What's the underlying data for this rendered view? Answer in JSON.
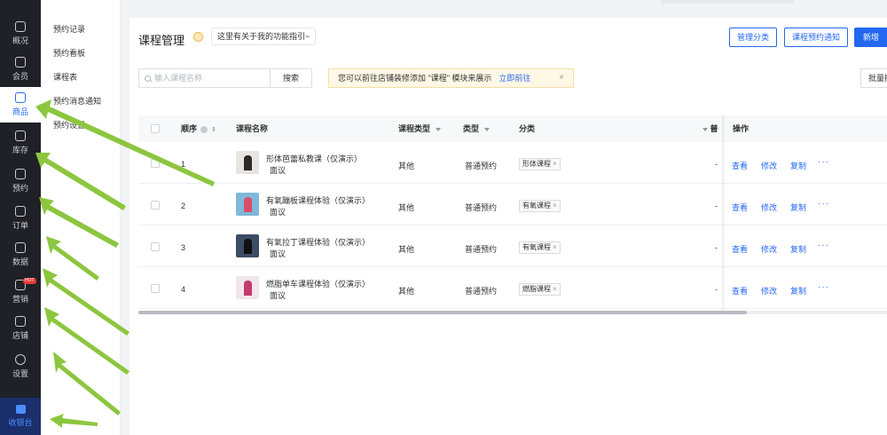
{
  "nav": {
    "items": [
      {
        "label": "概况",
        "icon": "overview-icon"
      },
      {
        "label": "会员",
        "icon": "member-icon"
      },
      {
        "label": "商品",
        "icon": "goods-icon",
        "active": true
      },
      {
        "label": "库存",
        "icon": "inventory-icon"
      },
      {
        "label": "预约",
        "icon": "booking-icon"
      },
      {
        "label": "订单",
        "icon": "order-icon"
      },
      {
        "label": "数据",
        "icon": "data-icon"
      },
      {
        "label": "营销",
        "icon": "marketing-icon",
        "badge": "HOT"
      },
      {
        "label": "店铺",
        "icon": "shop-icon"
      },
      {
        "label": "设置",
        "icon": "settings-icon"
      }
    ],
    "bottom": {
      "label": "收银台",
      "icon": "cashier-icon"
    }
  },
  "submenu": [
    "预约记录",
    "预约看板",
    "课程表",
    "预约消息通知",
    "预约设置"
  ],
  "header": {
    "title": "课程管理",
    "guide": "这里有关于我的功能指引~",
    "btn_category": "管理分类",
    "btn_notice": "课程预约通知",
    "btn_new": "新增课"
  },
  "toolbar": {
    "search_placeholder": "输入课程名称",
    "search_btn": "搜索",
    "notice_text": "您可以前往店铺装修添加 \"课程\" 模块来展示",
    "notice_link": "立即前往",
    "notice_close": "×",
    "batch": "批量操"
  },
  "table": {
    "headers": {
      "order": "顺序",
      "name": "课程名称",
      "course_type": "课程类型",
      "type": "类型",
      "category": "分类",
      "clipped": "普",
      "ops": "操作"
    },
    "rows": [
      {
        "order": "1",
        "name": "形体芭蕾私教课（仅演示）",
        "price": "面议",
        "course_type": "其他",
        "type": "普通预约",
        "category": "形体课程",
        "dash": "-"
      },
      {
        "order": "2",
        "name": "有氧蹦板课程体验（仅演示）",
        "price": "面议",
        "course_type": "其他",
        "type": "普通预约",
        "category": "有氧课程",
        "dash": "-"
      },
      {
        "order": "3",
        "name": "有氧拉丁课程体验（仅演示）",
        "price": "面议",
        "course_type": "其他",
        "type": "普通预约",
        "category": "有氧课程",
        "dash": "-"
      },
      {
        "order": "4",
        "name": "燃脂单车课程体验（仅演示）",
        "price": "面议",
        "course_type": "其他",
        "type": "普通预约",
        "category": "燃脂课程",
        "dash": "-"
      }
    ],
    "actions": {
      "view": "查看",
      "edit": "修改",
      "copy": "复制",
      "more": "···"
    },
    "tag_close": "×"
  },
  "colors": {
    "accent": "#2468f2",
    "nav_bg": "#1f2127",
    "arrow": "#8cc63f"
  }
}
